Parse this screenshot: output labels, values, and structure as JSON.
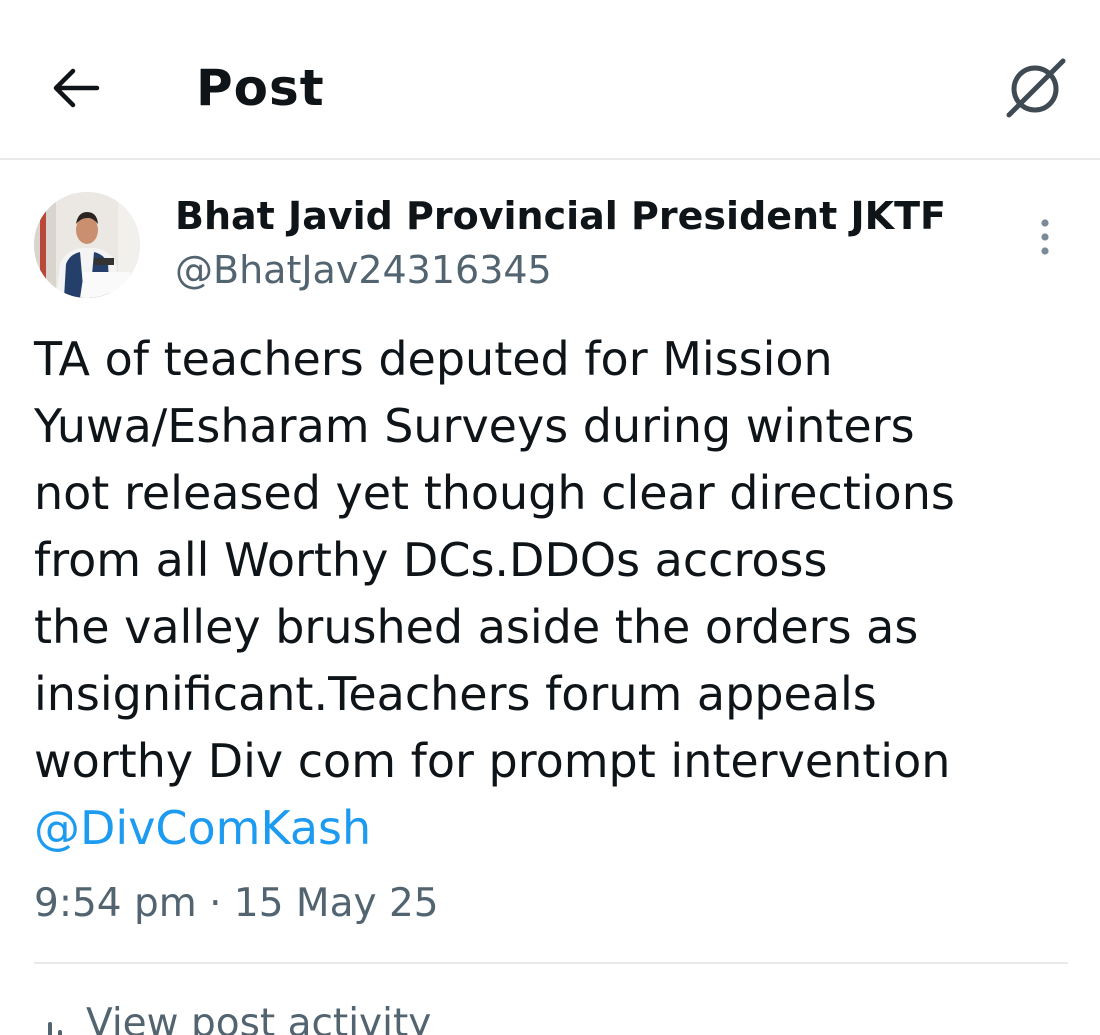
{
  "header": {
    "title": "Post",
    "back_icon": "arrow-left-icon",
    "grok_icon": "grok-icon"
  },
  "author": {
    "display_name": "Bhat Javid Provincial President JKTF",
    "handle": "@BhatJav24316345"
  },
  "post": {
    "lines": [
      "TA of teachers deputed for Mission",
      "Yuwa/Esharam Surveys during winters",
      "not released yet though clear directions",
      "from all Worthy DCs.DDOs accross",
      "the valley brushed aside the orders as",
      "insignificant.Teachers forum appeals",
      "worthy Div com for prompt intervention"
    ],
    "mention": "@DivComKash",
    "timestamp": "9:54 pm · 15 May 25"
  },
  "footer": {
    "activity_label": "View post activity",
    "activity_icon": "bar-chart-icon"
  },
  "colors": {
    "text": "#0f1419",
    "secondary": "#536471",
    "link": "#1d9bf0",
    "divider": "#e7e9ea"
  }
}
